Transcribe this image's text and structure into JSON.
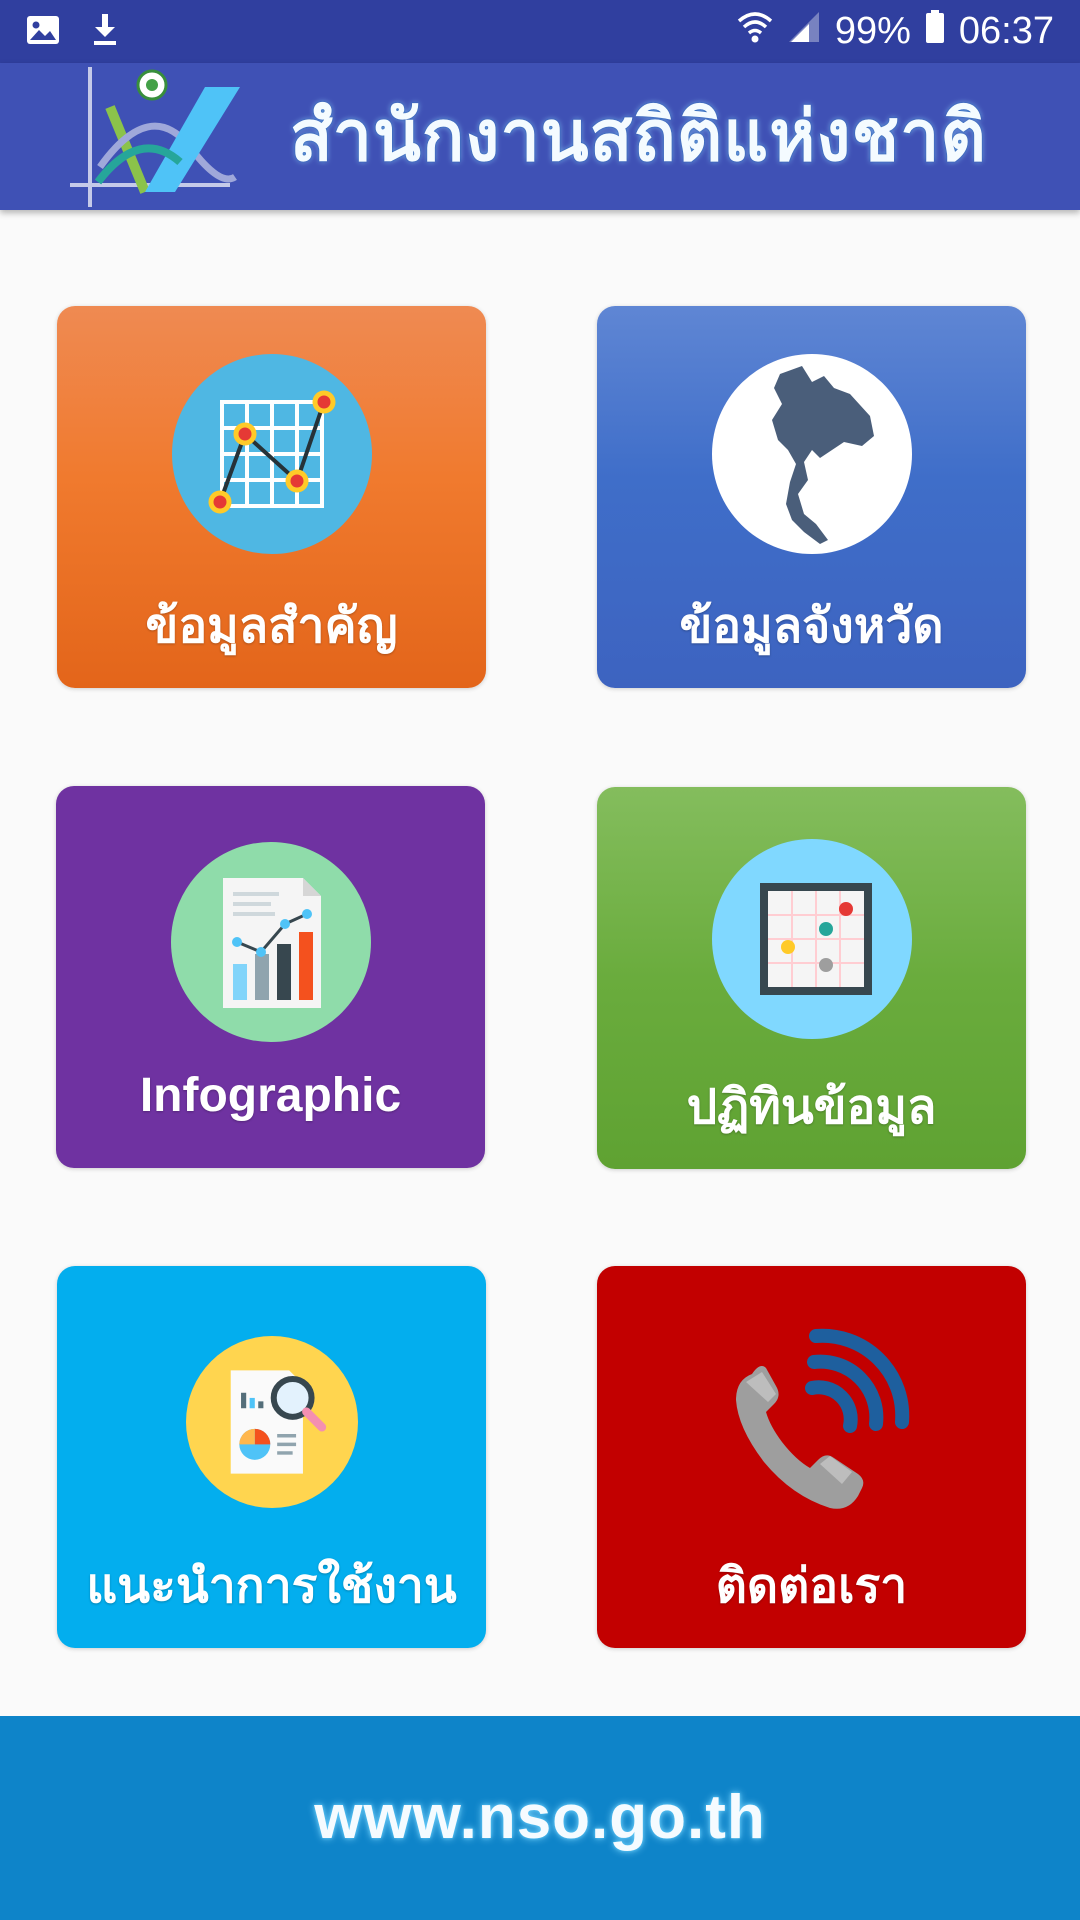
{
  "status_bar": {
    "icons": [
      "image-icon",
      "download-icon",
      "wifi-icon",
      "signal-icon",
      "battery-icon"
    ],
    "battery": "99%",
    "time": "06:37"
  },
  "app_bar": {
    "logo": "nso-logo",
    "title": "สำนักงานสถิติแห่งชาติ"
  },
  "tiles": [
    {
      "label": "ข้อมูลสำคัญ",
      "icon": "line-chart-icon",
      "color": "#f07a2e"
    },
    {
      "label": "ข้อมูลจังหวัด",
      "icon": "thailand-map-icon",
      "color": "#3f6ec9"
    },
    {
      "label": "Infographic",
      "icon": "report-chart-icon",
      "color": "#6f32a1"
    },
    {
      "label": "ปฏิทินข้อมูล",
      "icon": "data-calendar-icon",
      "color": "#6aac3d"
    },
    {
      "label": "แนะนำการใช้งาน",
      "icon": "document-search-icon",
      "color": "#03aeee"
    },
    {
      "label": "ติดต่อเรา",
      "icon": "phone-call-icon",
      "color": "#c20000"
    }
  ],
  "footer": {
    "url": "www.nso.go.th",
    "color": "#0e84c9"
  }
}
